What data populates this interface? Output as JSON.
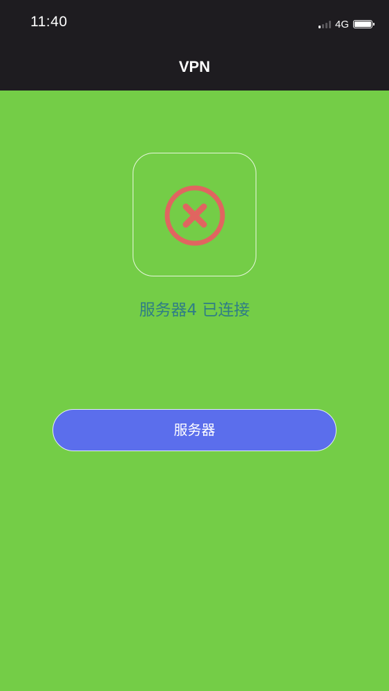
{
  "status_bar": {
    "time": "11:40",
    "network": "4G"
  },
  "nav": {
    "title": "VPN"
  },
  "connection": {
    "icon": "close-circle-icon",
    "status_text": "服务器4 已连接"
  },
  "actions": {
    "server_button_label": "服务器"
  },
  "colors": {
    "background": "#74CD47",
    "topbar": "#1E1C20",
    "status_text": "#2F7D86",
    "button": "#5B6EEC",
    "error_icon": "#E06560"
  }
}
